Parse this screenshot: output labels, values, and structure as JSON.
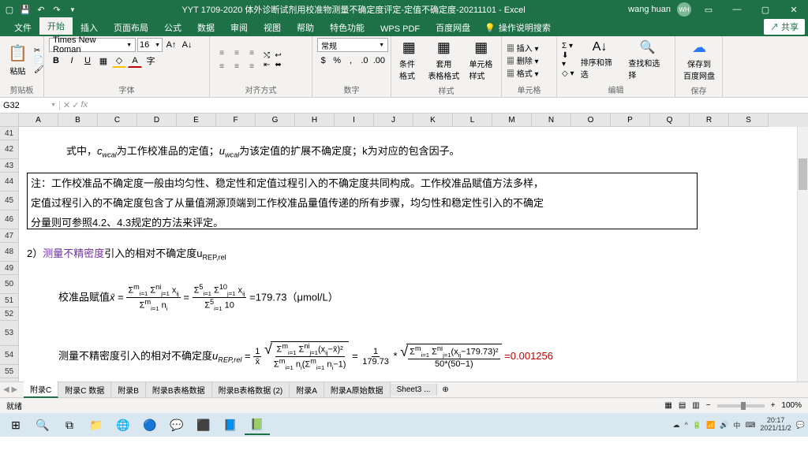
{
  "title": "YYT 1709-2020 体外诊断试剂用校准物测量不确定度评定-定值不确定度-20211101  -  Excel",
  "user": "wang huan",
  "user_initials": "WH",
  "tabs": [
    "文件",
    "开始",
    "插入",
    "页面布局",
    "公式",
    "数据",
    "审阅",
    "视图",
    "帮助",
    "特色功能",
    "WPS PDF",
    "百度网盘"
  ],
  "active_tab": 1,
  "tell_me": "操作说明搜索",
  "share": "共享",
  "ribbon": {
    "clipboard": {
      "label": "剪贴板",
      "paste": "粘贴"
    },
    "font": {
      "label": "字体",
      "name": "Times New Roman",
      "size": "16"
    },
    "align": {
      "label": "对齐方式"
    },
    "number": {
      "label": "数字",
      "format": "常规"
    },
    "styles": {
      "label": "样式",
      "cond": "条件格式",
      "table": "套用\n表格格式",
      "cell": "单元格样式"
    },
    "cells": {
      "label": "单元格",
      "insert": "插入",
      "delete": "删除",
      "format": "格式"
    },
    "editing": {
      "label": "编辑",
      "sort": "排序和筛选",
      "find": "查找和选择"
    },
    "save": {
      "label": "保存",
      "baidu": "保存到\n百度网盘"
    }
  },
  "name_box": "G32",
  "columns": [
    "A",
    "B",
    "C",
    "D",
    "E",
    "F",
    "G",
    "H",
    "I",
    "J",
    "K",
    "L",
    "M",
    "N",
    "O",
    "P",
    "Q",
    "R",
    "S"
  ],
  "rows": [
    "41",
    "42",
    "43",
    "44",
    "45",
    "46",
    "47",
    "48",
    "49",
    "50",
    "51",
    "52",
    "53",
    "54",
    "55"
  ],
  "content": {
    "line42a": "式中，",
    "line42b": "为工作校准品的定值；",
    "line42c": "为该定值的扩展不确定度；k为对应的包含因子。",
    "note_l1": "注：工作校准品不确定度一般由均匀性、稳定性和定值过程引入的不确定度共同构成。工作校准品赋值方法多样，",
    "note_l2": "定值过程引入的不确定度包含了从量值溯源顶端到工作校准品量值传递的所有步骤，均匀性和稳定性引入的不确定",
    "note_l3": "分量则可参照4.2、4.3规定的方法来评定。",
    "line48a": "2）",
    "line48b": "测量不精密度",
    "line48c": "引入的相对不确定度u",
    "line48d": "REP,rel",
    "line50a": "校准品赋值",
    "line50_eq_result": "=179.73（μmol/L）",
    "line54a": "测量不精密度引入的相对不确定度",
    "line54_result": "=0.001256"
  },
  "sheets": [
    "附录C",
    "附录C 数据",
    "附录B",
    "附录B表格数据",
    "附录B表格数据 (2)",
    "附录A",
    "附录A原始数据",
    "Sheet3 ..."
  ],
  "active_sheet": 0,
  "status": "就绪",
  "zoom": "100%",
  "time": "20:17",
  "date": "2021/11/2"
}
